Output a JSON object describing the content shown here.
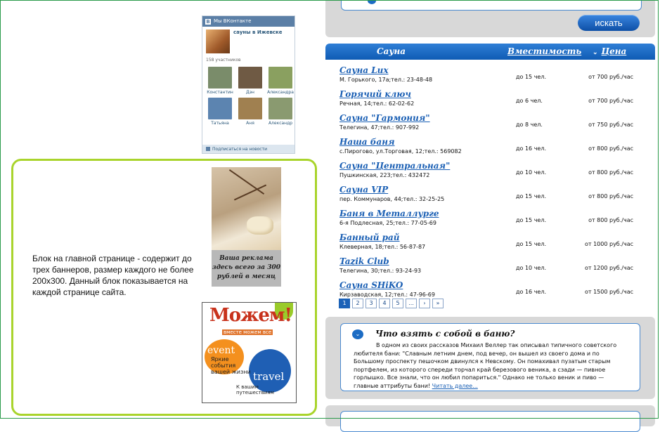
{
  "vk_widget": {
    "header": "Мы ВКонтакте",
    "group_name": "сауны в Ижевске",
    "members": "158 участников",
    "people": [
      {
        "name": "Константин",
        "color": "#7a8c6a"
      },
      {
        "name": "Дэн",
        "color": "#6f5a44"
      },
      {
        "name": "Александра",
        "color": "#8aa060"
      },
      {
        "name": "Татьяна",
        "color": "#5c84b0"
      },
      {
        "name": "Аня",
        "color": "#a08050"
      },
      {
        "name": "Александр",
        "color": "#8a9a70"
      }
    ],
    "subscribe": "Подписаться на новости"
  },
  "banner_block": {
    "description": "Блок на главной странице - содержит до трех баннеров, размер каждого не более 200х300. Данный блок показывается на каждой странице сайта.",
    "ad1_caption": "Ваша реклама здесь всего за 300 рублей в месяц",
    "ad2": {
      "title": "Можем!",
      "subtitle": "вместе можем все",
      "event": "event",
      "event_text": "Яркие события вашей жизни",
      "travel": "travel",
      "travel_text": "К вашим путешествиям"
    }
  },
  "search": {
    "button": "искать"
  },
  "table": {
    "headers": {
      "sauna": "Сауна",
      "capacity": "Вместимость",
      "sort_arrow": "⌄",
      "price": "Цена"
    },
    "rows": [
      {
        "name": "Сауна Lux",
        "addr": "М. Горького, 17а;тел.: 23-48-48",
        "cap": "до 15 чел.",
        "price": "от 700 руб./час"
      },
      {
        "name": "Горячий ключ",
        "addr": "Речная, 14;тел.: 62-02-62",
        "cap": "до 6 чел.",
        "price": "от 700 руб./час"
      },
      {
        "name": "Сауна \"Гармония\"",
        "addr": "Телегина, 47;тел.: 907-992",
        "cap": "до 8 чел.",
        "price": "от 750 руб./час"
      },
      {
        "name": "Наша баня",
        "addr": "с.Пирогово, ул.Торговая, 12;тел.: 569082",
        "cap": "до 16 чел.",
        "price": "от 800 руб./час"
      },
      {
        "name": "Сауна \"Центральная\"",
        "addr": "Пушкинская, 223;тел.: 432472",
        "cap": "до 10 чел.",
        "price": "от 800 руб./час"
      },
      {
        "name": "Сауна VIP",
        "addr": "пер. Коммунаров, 44;тел.: 32-25-25",
        "cap": "до 15 чел.",
        "price": "от 800 руб./час"
      },
      {
        "name": "Баня в Металлурге",
        "addr": "6-я Подлесная, 25;тел.: 77-05-69",
        "cap": "до 15 чел.",
        "price": "от 800 руб./час"
      },
      {
        "name": "Банный рай",
        "addr": "Клеверная, 18;тел.: 56-87-87",
        "cap": "до 15 чел.",
        "price": "от 1000 руб./час"
      },
      {
        "name": "Tazik Club",
        "addr": "Телегина, 30;тел.: 93-24-93",
        "cap": "до 10 чел.",
        "price": "от 1200 руб./час"
      },
      {
        "name": "Сауна SHiKO",
        "addr": "Кирзаводская, 12;тел.: 47-96-69",
        "cap": "до 16 чел.",
        "price": "от 1500 руб./час"
      }
    ]
  },
  "pager": [
    "1",
    "2",
    "3",
    "4",
    "5",
    "...",
    "›",
    "»"
  ],
  "article": {
    "title": "Что взять с собой в баню?",
    "text": "В одном из своих рассказов Михаил Веллер так описывал типичного советского любителя бани: \"Славным летним днем, под вечер, он вышел из своего дома и по Большому проспекту пешочком двинулся к Невскому. Он помахивал пузатым старым портфелем, из которого спереди торчал край березового веника, а сзади — пивное горлышко. Все знали, что он любил попариться.\" Однако не только веник и пиво — главные аттрибуты бани! ",
    "link": "Читать далее..."
  }
}
